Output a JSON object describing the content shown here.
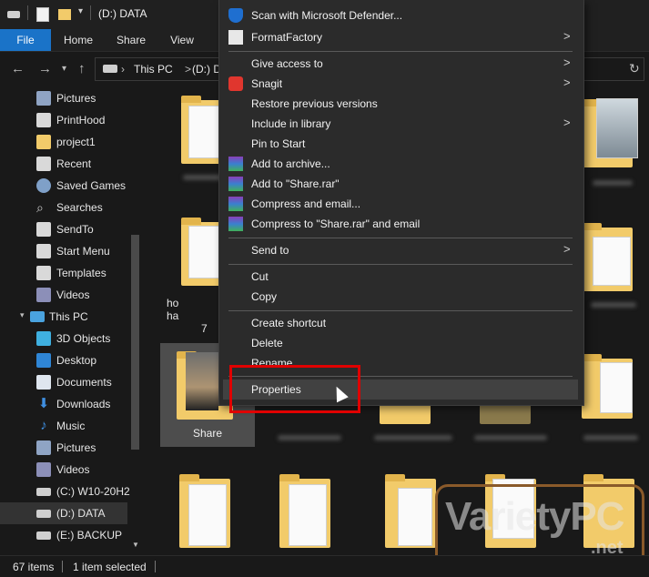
{
  "window": {
    "title": "(D:) DATA"
  },
  "ribbon": {
    "tabs": [
      "File",
      "Home",
      "Share",
      "View"
    ]
  },
  "address": {
    "crumb_this_pc": "This PC",
    "separator": ">",
    "crumb_drive": "(D:) D"
  },
  "sidebar": {
    "items": [
      {
        "label": "Pictures",
        "icon": "pictures-icon"
      },
      {
        "label": "PrintHood",
        "icon": "folder-shortcut-icon"
      },
      {
        "label": "project1",
        "icon": "folder-icon"
      },
      {
        "label": "Recent",
        "icon": "folder-shortcut-icon"
      },
      {
        "label": "Saved Games",
        "icon": "saved-games-icon"
      },
      {
        "label": "Searches",
        "icon": "search-icon"
      },
      {
        "label": "SendTo",
        "icon": "folder-shortcut-icon"
      },
      {
        "label": "Start Menu",
        "icon": "folder-shortcut-icon"
      },
      {
        "label": "Templates",
        "icon": "folder-shortcut-icon"
      },
      {
        "label": "Videos",
        "icon": "videos-icon"
      },
      {
        "label": "This PC",
        "icon": "computer-icon"
      },
      {
        "label": "3D Objects",
        "icon": "3d-objects-icon"
      },
      {
        "label": "Desktop",
        "icon": "desktop-icon"
      },
      {
        "label": "Documents",
        "icon": "documents-icon"
      },
      {
        "label": "Downloads",
        "icon": "downloads-icon"
      },
      {
        "label": "Music",
        "icon": "music-icon"
      },
      {
        "label": "Pictures",
        "icon": "pictures-icon"
      },
      {
        "label": "Videos",
        "icon": "videos-icon"
      },
      {
        "label": "(C:) W10-20H2",
        "icon": "drive-icon"
      },
      {
        "label": "(D:) DATA",
        "icon": "drive-icon"
      },
      {
        "label": "(E:) BACKUP",
        "icon": "drive-icon"
      }
    ]
  },
  "content": {
    "selected_label": "Share",
    "partial_label_1": "ho",
    "partial_label_2": "ha",
    "partial_label_3": "7"
  },
  "context_menu": {
    "items": {
      "scan": "Scan with Microsoft Defender...",
      "formatfactory": "FormatFactory",
      "give_access": "Give access to",
      "snagit": "Snagit",
      "restore": "Restore previous versions",
      "include_library": "Include in library",
      "pin_start": "Pin to Start",
      "add_archive": "Add to archive...",
      "add_share_rar": "Add to \"Share.rar\"",
      "compress_email": "Compress and email...",
      "compress_share_email": "Compress to \"Share.rar\" and email",
      "send_to": "Send to",
      "cut": "Cut",
      "copy": "Copy",
      "create_shortcut": "Create shortcut",
      "delete": "Delete",
      "rename": "Rename",
      "properties": "Properties"
    },
    "submenu_arrow": ">"
  },
  "watermark": {
    "text": "VarietyPC",
    "suffix": ".net"
  },
  "status": {
    "item_count": "67 items",
    "selected": "1 item selected"
  },
  "colors": {
    "accent": "#1a73c8",
    "highlight_box": "#e00000",
    "background": "#191919"
  }
}
